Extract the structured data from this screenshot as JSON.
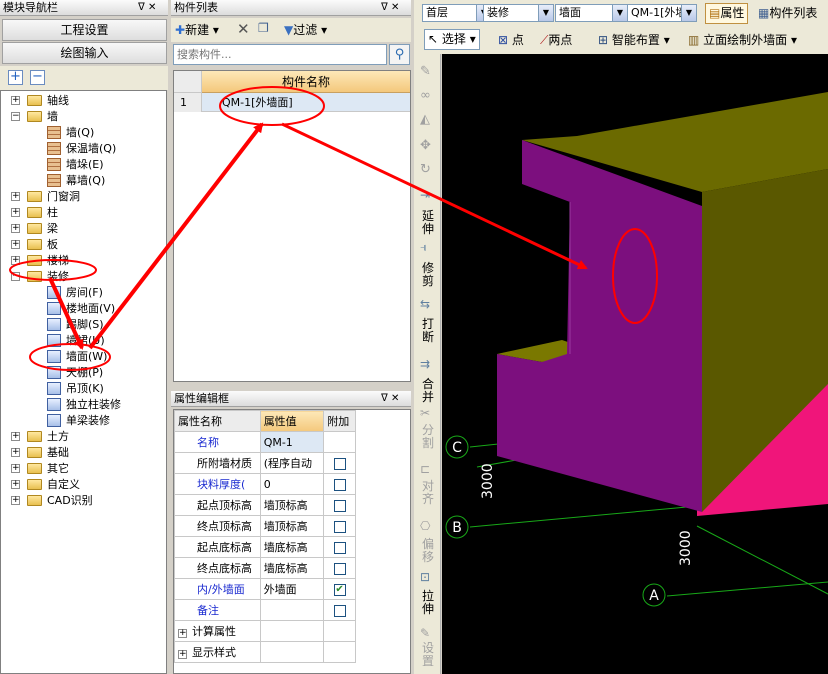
{
  "nav": {
    "title": "模块导航栏",
    "pin": "ᐁ ✕",
    "btn_project": "工程设置",
    "btn_drawing": "绘图输入",
    "tree": [
      {
        "label": "轴线",
        "exp": "+"
      },
      {
        "label": "墙",
        "exp": "−"
      },
      {
        "label": "墙(Q)"
      },
      {
        "label": "保温墙(Q)"
      },
      {
        "label": "墙垛(E)"
      },
      {
        "label": "幕墙(Q)"
      },
      {
        "label": "门窗洞",
        "exp": "+"
      },
      {
        "label": "柱",
        "exp": "+"
      },
      {
        "label": "梁",
        "exp": "+"
      },
      {
        "label": "板",
        "exp": "+"
      },
      {
        "label": "楼梯",
        "exp": "+"
      },
      {
        "label": "装修",
        "exp": "−"
      },
      {
        "label": "房间(F)"
      },
      {
        "label": "楼地面(V)"
      },
      {
        "label": "踢脚(S)"
      },
      {
        "label": "墙裙(U)"
      },
      {
        "label": "墙面(W)"
      },
      {
        "label": "天棚(P)"
      },
      {
        "label": "吊顶(K)"
      },
      {
        "label": "独立柱装修"
      },
      {
        "label": "单梁装修"
      },
      {
        "label": "土方",
        "exp": "+"
      },
      {
        "label": "基础",
        "exp": "+"
      },
      {
        "label": "其它",
        "exp": "+"
      },
      {
        "label": "自定义",
        "exp": "+"
      },
      {
        "label": "CAD识别",
        "exp": "+"
      }
    ]
  },
  "comp": {
    "title": "构件列表",
    "new": "新建",
    "filter": "过滤",
    "search_placeholder": "搜索构件...",
    "header": "构件名称",
    "row_num": "1",
    "row_name": "QM-1[外墙面]"
  },
  "prop": {
    "title": "属性编辑框",
    "h_name": "属性名称",
    "h_val": "属性值",
    "h_add": "附加",
    "rows": [
      {
        "n": "名称",
        "v": "QM-1",
        "blue": true,
        "chk": ""
      },
      {
        "n": "所附墙材质",
        "v": "(程序自动",
        "chk": "box"
      },
      {
        "n": "块料厚度(",
        "v": "0",
        "blue": true,
        "chk": "box"
      },
      {
        "n": "起点顶标高",
        "v": "墙顶标高",
        "chk": "box"
      },
      {
        "n": "终点顶标高",
        "v": "墙顶标高",
        "chk": "box"
      },
      {
        "n": "起点底标高",
        "v": "墙底标高",
        "chk": "box"
      },
      {
        "n": "终点底标高",
        "v": "墙底标高",
        "chk": "box"
      },
      {
        "n": "内/外墙面",
        "v": "外墙面",
        "blue": true,
        "chk": "checked"
      },
      {
        "n": "备注",
        "v": "",
        "blue": true,
        "chk": "box"
      },
      {
        "n": "计算属性",
        "v": "",
        "exp": "+"
      },
      {
        "n": "显示样式",
        "v": "",
        "exp": "+"
      }
    ]
  },
  "toolbar": {
    "floor": "首层",
    "cat": "装修",
    "type": "墙面",
    "item": "QM-1[外墙",
    "attr": "属性",
    "complist": "构件列表",
    "select": "选择",
    "point": "点",
    "twopoint": "两点",
    "smart": "智能布置",
    "elev": "立面绘制外墙面"
  },
  "side": [
    "延伸",
    "修剪",
    "打断",
    "合并",
    "分割",
    "对齐",
    "偏移",
    "拉伸",
    "设置"
  ],
  "canvas": {
    "axisC": "C",
    "axisB": "B",
    "axisA": "A",
    "dim1": "3000",
    "dim2": "3000"
  },
  "colors": {
    "purple": "#7c0f7e",
    "olive": "#6b6a00",
    "pink": "#f0157a",
    "grid": "#18a818",
    "red": "#ff0000"
  }
}
